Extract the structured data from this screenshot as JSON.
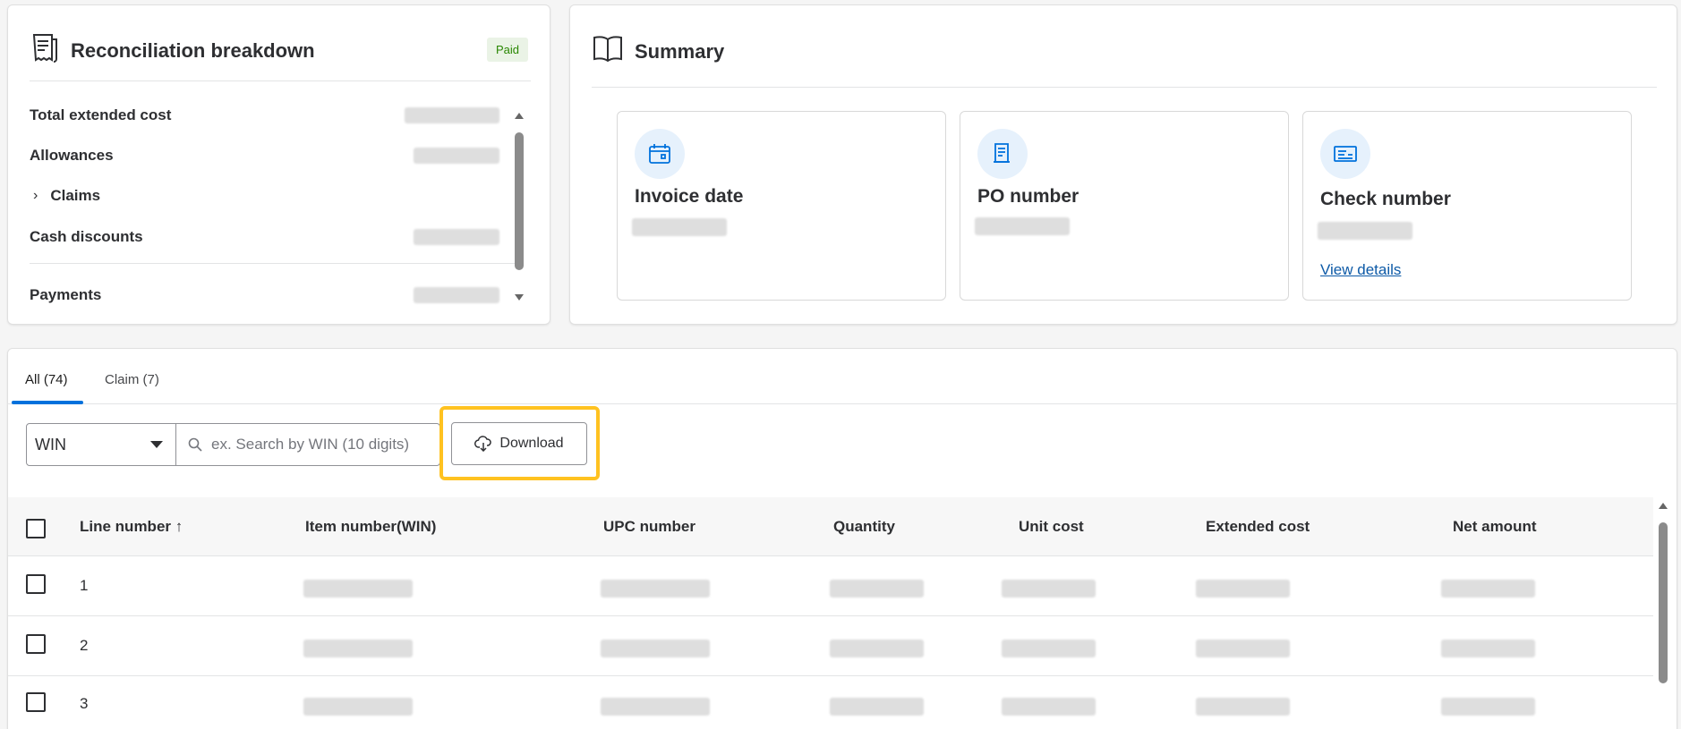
{
  "reconciliation": {
    "title": "Reconciliation breakdown",
    "status_badge": "Paid",
    "rows": [
      {
        "label": "Total extended cost"
      },
      {
        "label": "Allowances"
      },
      {
        "label": "Claims"
      },
      {
        "label": "Cash discounts"
      },
      {
        "label": "Payments"
      }
    ]
  },
  "summary": {
    "title": "Summary",
    "tiles": [
      {
        "label": "Invoice date",
        "icon": "calendar-icon"
      },
      {
        "label": "PO number",
        "icon": "document-icon"
      },
      {
        "label": "Check number",
        "icon": "check-icon",
        "link": "View details"
      }
    ]
  },
  "tabs": [
    {
      "label": "All (74)",
      "active": true
    },
    {
      "label": "Claim (7)",
      "active": false
    }
  ],
  "filter": {
    "selected": "WIN",
    "search_placeholder": "ex. Search by WIN (10 digits)"
  },
  "download_label": "Download",
  "table": {
    "columns": [
      "Line number",
      "Item number(WIN)",
      "UPC number",
      "Quantity",
      "Unit cost",
      "Extended cost",
      "Net amount"
    ],
    "sort_indicator": "↑",
    "rows": [
      {
        "line": "1"
      },
      {
        "line": "2"
      },
      {
        "line": "3"
      }
    ]
  },
  "colors": {
    "accent": "#0071dc",
    "highlight": "#ffc220",
    "badge_bg": "#eaf3e6",
    "badge_text": "#2a8703",
    "link": "#0d5aa7"
  }
}
